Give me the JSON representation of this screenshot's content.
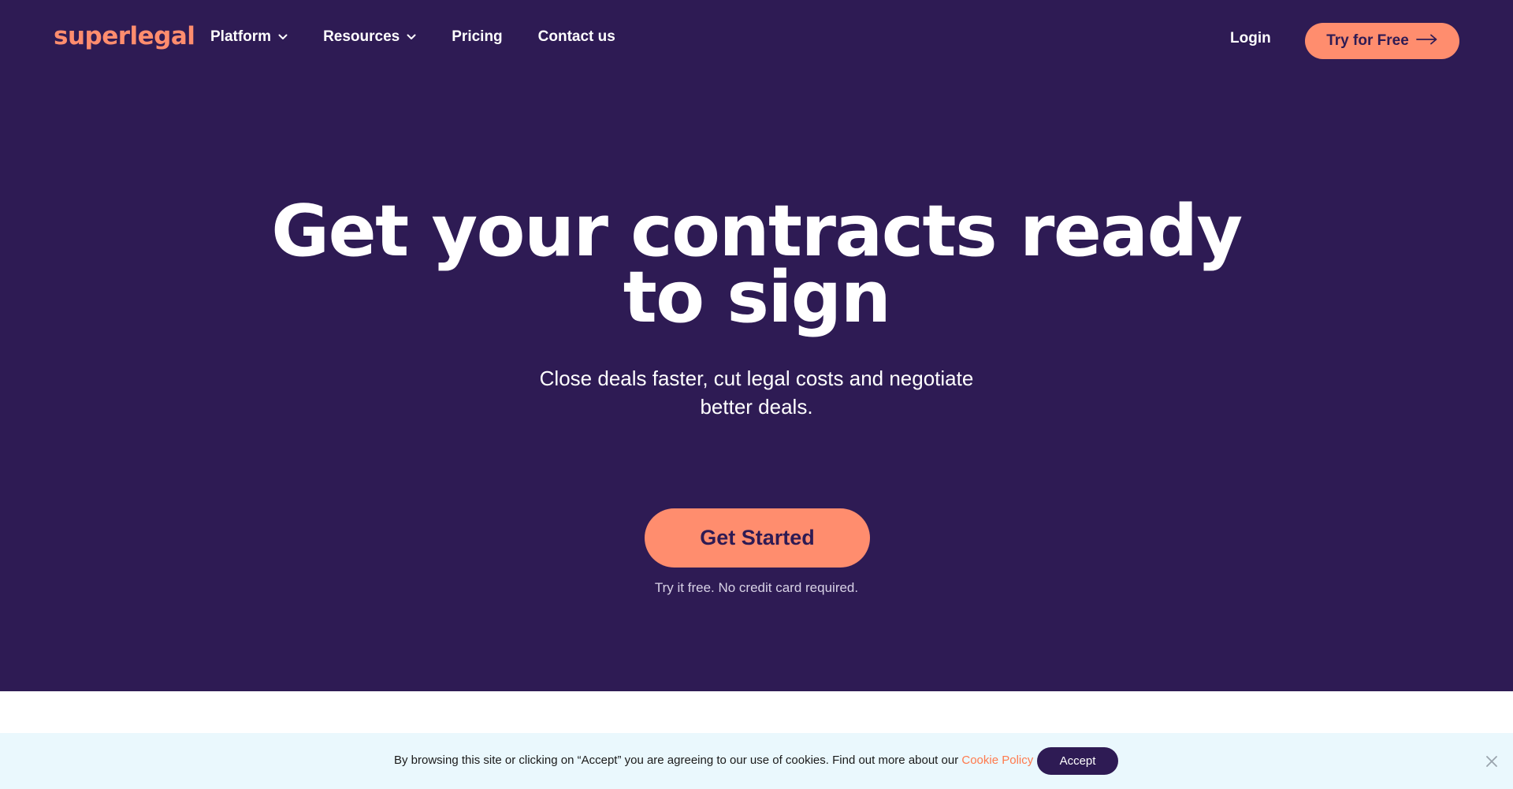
{
  "colors": {
    "hero_bg": "#2e1b54",
    "accent": "#ff8d6e",
    "cookie_bg": "#eaf8fd",
    "cookie_link": "#ff7a4d"
  },
  "nav": {
    "logo": "superlegal",
    "items": [
      {
        "label": "Platform",
        "has_dropdown": true
      },
      {
        "label": "Resources",
        "has_dropdown": true
      },
      {
        "label": "Pricing",
        "has_dropdown": false
      },
      {
        "label": "Contact us",
        "has_dropdown": false
      }
    ],
    "login": "Login",
    "try_free": "Try for Free",
    "try_free_icon": "arrow-right-icon"
  },
  "hero": {
    "headline_line1": "Get your contracts ready",
    "headline_line2": "to sign",
    "subhead_line1": "Close deals faster, cut legal costs and negotiate",
    "subhead_line2": "better deals.",
    "cta": "Get Started",
    "cta_note": "Try it free. No credit card required."
  },
  "cookie": {
    "text": "By browsing this site or clicking on “Accept” you are agreeing to our use of cookies. Find out more about our ",
    "link": "Cookie Policy",
    "accept": "Accept",
    "close_icon": "close-icon"
  }
}
